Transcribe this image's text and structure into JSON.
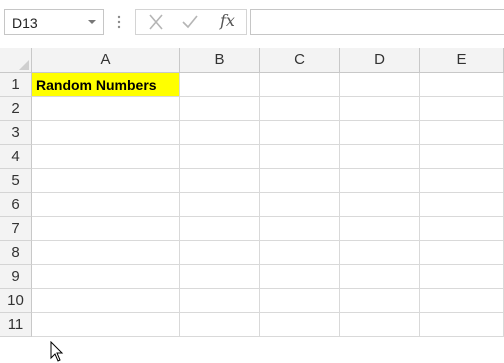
{
  "formula_bar": {
    "name_box": "D13",
    "name_box_dropdown_icon": "chevron-down-icon",
    "cancel_icon": "close-icon",
    "enter_icon": "checkmark-icon",
    "function_label": "fx",
    "formula": ""
  },
  "columns": [
    "A",
    "B",
    "C",
    "D",
    "E"
  ],
  "rows": [
    "1",
    "2",
    "3",
    "4",
    "5",
    "6",
    "7",
    "8",
    "9",
    "10",
    "11"
  ],
  "cells": {
    "A1": {
      "text": "Random Numbers",
      "fill": "#ffff00",
      "bold": true
    }
  },
  "colors": {
    "header_bg": "#f3f3f3",
    "gridline": "#d9d9d9",
    "highlight": "#ffff00"
  },
  "pointer": "arrow-cursor-icon"
}
